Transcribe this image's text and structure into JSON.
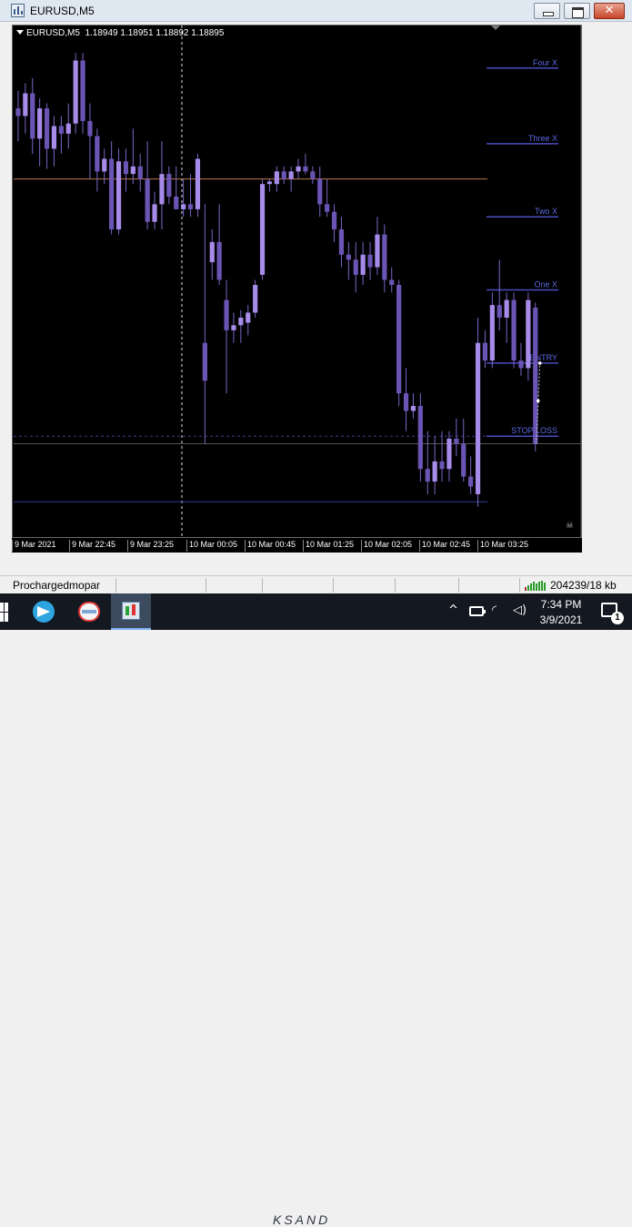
{
  "window": {
    "title": "EURUSD,M5",
    "close_glyph": "✕"
  },
  "chart": {
    "symbol": "EURUSD,M5",
    "ohlc": "1.18949 1.18951 1.18892 1.18895",
    "current_price": "1.18895",
    "colors": {
      "background": "#000000",
      "bull": "#a78be8",
      "bear": "#6a55b5",
      "wick": "#7a66c6",
      "level_line": "#4a4ec0",
      "level_text": "#5b69e0",
      "orange_line": "#c07a4e",
      "bottom_line": "#2f3aa0",
      "axis_text": "#ffffff"
    }
  },
  "chart_data": {
    "type": "candlestick",
    "title": "EURUSD,M5",
    "timeframe": "M5",
    "ylim": [
      1.18858,
      1.19058
    ],
    "y_ticks": [
      "1.19045",
      "1.19030",
      "1.19015",
      "1.19000",
      "1.18985",
      "1.18970",
      "1.18955",
      "1.18940",
      "1.18925",
      "1.18910",
      "1.18880",
      "1.18865"
    ],
    "x_ticks": [
      "9 Mar 2021",
      "9 Mar 22:45",
      "9 Mar 23:25",
      "10 Mar 00:05",
      "10 Mar 00:45",
      "10 Mar 01:25",
      "10 Mar 02:05",
      "10 Mar 02:45",
      "10 Mar 03:25"
    ],
    "horizontal_lines": [
      {
        "label": "Four X",
        "price": 1.19044
      },
      {
        "label": "Three X",
        "price": 1.19014
      },
      {
        "label": "Two X",
        "price": 1.18985
      },
      {
        "label": "One X",
        "price": 1.18956
      },
      {
        "label": "ENTRY",
        "price": 1.18927
      },
      {
        "label": "STOP LOSS",
        "price": 1.18898
      },
      {
        "label": "",
        "price": 1.19
      },
      {
        "label": "",
        "price": 1.18872
      }
    ],
    "candles": [
      {
        "o": 1.19028,
        "h": 1.19035,
        "l": 1.19015,
        "c": 1.19025
      },
      {
        "o": 1.19025,
        "h": 1.19038,
        "l": 1.19018,
        "c": 1.19034
      },
      {
        "o": 1.19034,
        "h": 1.1904,
        "l": 1.1901,
        "c": 1.19016
      },
      {
        "o": 1.19016,
        "h": 1.19032,
        "l": 1.19005,
        "c": 1.19028
      },
      {
        "o": 1.19028,
        "h": 1.1903,
        "l": 1.19004,
        "c": 1.19012
      },
      {
        "o": 1.19012,
        "h": 1.19025,
        "l": 1.19005,
        "c": 1.19021
      },
      {
        "o": 1.19021,
        "h": 1.19025,
        "l": 1.1901,
        "c": 1.19018
      },
      {
        "o": 1.19018,
        "h": 1.1903,
        "l": 1.19012,
        "c": 1.19022
      },
      {
        "o": 1.19022,
        "h": 1.1905,
        "l": 1.19018,
        "c": 1.19047
      },
      {
        "o": 1.19047,
        "h": 1.1905,
        "l": 1.19018,
        "c": 1.19023
      },
      {
        "o": 1.19023,
        "h": 1.1903,
        "l": 1.19,
        "c": 1.19017
      },
      {
        "o": 1.19017,
        "h": 1.1902,
        "l": 1.18995,
        "c": 1.19003
      },
      {
        "o": 1.19003,
        "h": 1.19012,
        "l": 1.18998,
        "c": 1.19008
      },
      {
        "o": 1.19008,
        "h": 1.19015,
        "l": 1.18978,
        "c": 1.1898
      },
      {
        "o": 1.1898,
        "h": 1.19012,
        "l": 1.18978,
        "c": 1.19007
      },
      {
        "o": 1.19007,
        "h": 1.19012,
        "l": 1.18995,
        "c": 1.19002
      },
      {
        "o": 1.19002,
        "h": 1.1902,
        "l": 1.18998,
        "c": 1.19005
      },
      {
        "o": 1.19005,
        "h": 1.1901,
        "l": 1.18995,
        "c": 1.19
      },
      {
        "o": 1.19,
        "h": 1.19015,
        "l": 1.1898,
        "c": 1.18983
      },
      {
        "o": 1.18983,
        "h": 1.18995,
        "l": 1.1898,
        "c": 1.1899
      },
      {
        "o": 1.1899,
        "h": 1.19015,
        "l": 1.1898,
        "c": 1.19002
      },
      {
        "o": 1.19002,
        "h": 1.19005,
        "l": 1.1899,
        "c": 1.18993
      },
      {
        "o": 1.18993,
        "h": 1.19005,
        "l": 1.18988,
        "c": 1.18988
      },
      {
        "o": 1.18988,
        "h": 1.19,
        "l": 1.18985,
        "c": 1.1899
      },
      {
        "o": 1.1899,
        "h": 1.19002,
        "l": 1.18985,
        "c": 1.18988
      },
      {
        "o": 1.18988,
        "h": 1.1901,
        "l": 1.18985,
        "c": 1.19008
      },
      {
        "o": 1.18935,
        "h": 1.1899,
        "l": 1.18895,
        "c": 1.1892
      },
      {
        "o": 1.18967,
        "h": 1.1898,
        "l": 1.1896,
        "c": 1.18975
      },
      {
        "o": 1.18975,
        "h": 1.1899,
        "l": 1.18958,
        "c": 1.1896
      },
      {
        "o": 1.18952,
        "h": 1.1896,
        "l": 1.18915,
        "c": 1.1894
      },
      {
        "o": 1.1894,
        "h": 1.18947,
        "l": 1.18935,
        "c": 1.18942
      },
      {
        "o": 1.18942,
        "h": 1.18948,
        "l": 1.18935,
        "c": 1.18945
      },
      {
        "o": 1.18943,
        "h": 1.1895,
        "l": 1.18938,
        "c": 1.18947
      },
      {
        "o": 1.18947,
        "h": 1.1896,
        "l": 1.18945,
        "c": 1.18958
      },
      {
        "o": 1.18962,
        "h": 1.19,
        "l": 1.1896,
        "c": 1.18998
      },
      {
        "o": 1.18998,
        "h": 1.19,
        "l": 1.18995,
        "c": 1.18999
      },
      {
        "o": 1.18998,
        "h": 1.19005,
        "l": 1.18995,
        "c": 1.19003
      },
      {
        "o": 1.19003,
        "h": 1.19005,
        "l": 1.18998,
        "c": 1.19
      },
      {
        "o": 1.19,
        "h": 1.19005,
        "l": 1.18995,
        "c": 1.19003
      },
      {
        "o": 1.19003,
        "h": 1.19008,
        "l": 1.19,
        "c": 1.19005
      },
      {
        "o": 1.19005,
        "h": 1.1901,
        "l": 1.19002,
        "c": 1.19003
      },
      {
        "o": 1.19003,
        "h": 1.19005,
        "l": 1.18998,
        "c": 1.19
      },
      {
        "o": 1.19,
        "h": 1.19005,
        "l": 1.18985,
        "c": 1.1899
      },
      {
        "o": 1.1899,
        "h": 1.19,
        "l": 1.18985,
        "c": 1.18987
      },
      {
        "o": 1.18987,
        "h": 1.1899,
        "l": 1.18975,
        "c": 1.1898
      },
      {
        "o": 1.1898,
        "h": 1.18985,
        "l": 1.18965,
        "c": 1.1897
      },
      {
        "o": 1.1897,
        "h": 1.18975,
        "l": 1.1896,
        "c": 1.18968
      },
      {
        "o": 1.18968,
        "h": 1.18975,
        "l": 1.18955,
        "c": 1.18962
      },
      {
        "o": 1.18962,
        "h": 1.18975,
        "l": 1.18958,
        "c": 1.1897
      },
      {
        "o": 1.1897,
        "h": 1.18975,
        "l": 1.1896,
        "c": 1.18965
      },
      {
        "o": 1.18965,
        "h": 1.18985,
        "l": 1.18962,
        "c": 1.18978
      },
      {
        "o": 1.18978,
        "h": 1.18982,
        "l": 1.18955,
        "c": 1.1896
      },
      {
        "o": 1.1896,
        "h": 1.18965,
        "l": 1.18955,
        "c": 1.18958
      },
      {
        "o": 1.18958,
        "h": 1.1896,
        "l": 1.1891,
        "c": 1.18915
      },
      {
        "o": 1.18915,
        "h": 1.18925,
        "l": 1.189,
        "c": 1.18908
      },
      {
        "o": 1.18908,
        "h": 1.18915,
        "l": 1.18905,
        "c": 1.1891
      },
      {
        "o": 1.1891,
        "h": 1.18915,
        "l": 1.1888,
        "c": 1.18885
      },
      {
        "o": 1.18885,
        "h": 1.189,
        "l": 1.18875,
        "c": 1.1888
      },
      {
        "o": 1.1888,
        "h": 1.18898,
        "l": 1.18875,
        "c": 1.18888
      },
      {
        "o": 1.18888,
        "h": 1.189,
        "l": 1.1888,
        "c": 1.18885
      },
      {
        "o": 1.18885,
        "h": 1.189,
        "l": 1.1888,
        "c": 1.18897
      },
      {
        "o": 1.18897,
        "h": 1.18905,
        "l": 1.1889,
        "c": 1.18895
      },
      {
        "o": 1.18895,
        "h": 1.18905,
        "l": 1.1888,
        "c": 1.18882
      },
      {
        "o": 1.18882,
        "h": 1.1889,
        "l": 1.18875,
        "c": 1.18878
      },
      {
        "o": 1.18875,
        "h": 1.18945,
        "l": 1.1887,
        "c": 1.18935
      },
      {
        "o": 1.18935,
        "h": 1.1894,
        "l": 1.18925,
        "c": 1.18928
      },
      {
        "o": 1.18928,
        "h": 1.18955,
        "l": 1.18925,
        "c": 1.1895
      },
      {
        "o": 1.1895,
        "h": 1.18968,
        "l": 1.1894,
        "c": 1.18945
      },
      {
        "o": 1.18945,
        "h": 1.18955,
        "l": 1.18935,
        "c": 1.18952
      },
      {
        "o": 1.18952,
        "h": 1.18955,
        "l": 1.18925,
        "c": 1.18928
      },
      {
        "o": 1.18928,
        "h": 1.18935,
        "l": 1.18922,
        "c": 1.18925
      },
      {
        "o": 1.18925,
        "h": 1.18955,
        "l": 1.1892,
        "c": 1.18952
      },
      {
        "o": 1.18949,
        "h": 1.18951,
        "l": 1.18892,
        "c": 1.18895
      }
    ]
  },
  "statusbar": {
    "profile": "Prochargedmopar",
    "traffic": "204239/18 kb"
  },
  "taskbar": {
    "watermark": "KSAND",
    "time": "7:34 PM",
    "date": "3/9/2021",
    "notification_count": "1",
    "tray_chevron": "^",
    "tray_wifi": "◜",
    "tray_volume": "◁)"
  }
}
